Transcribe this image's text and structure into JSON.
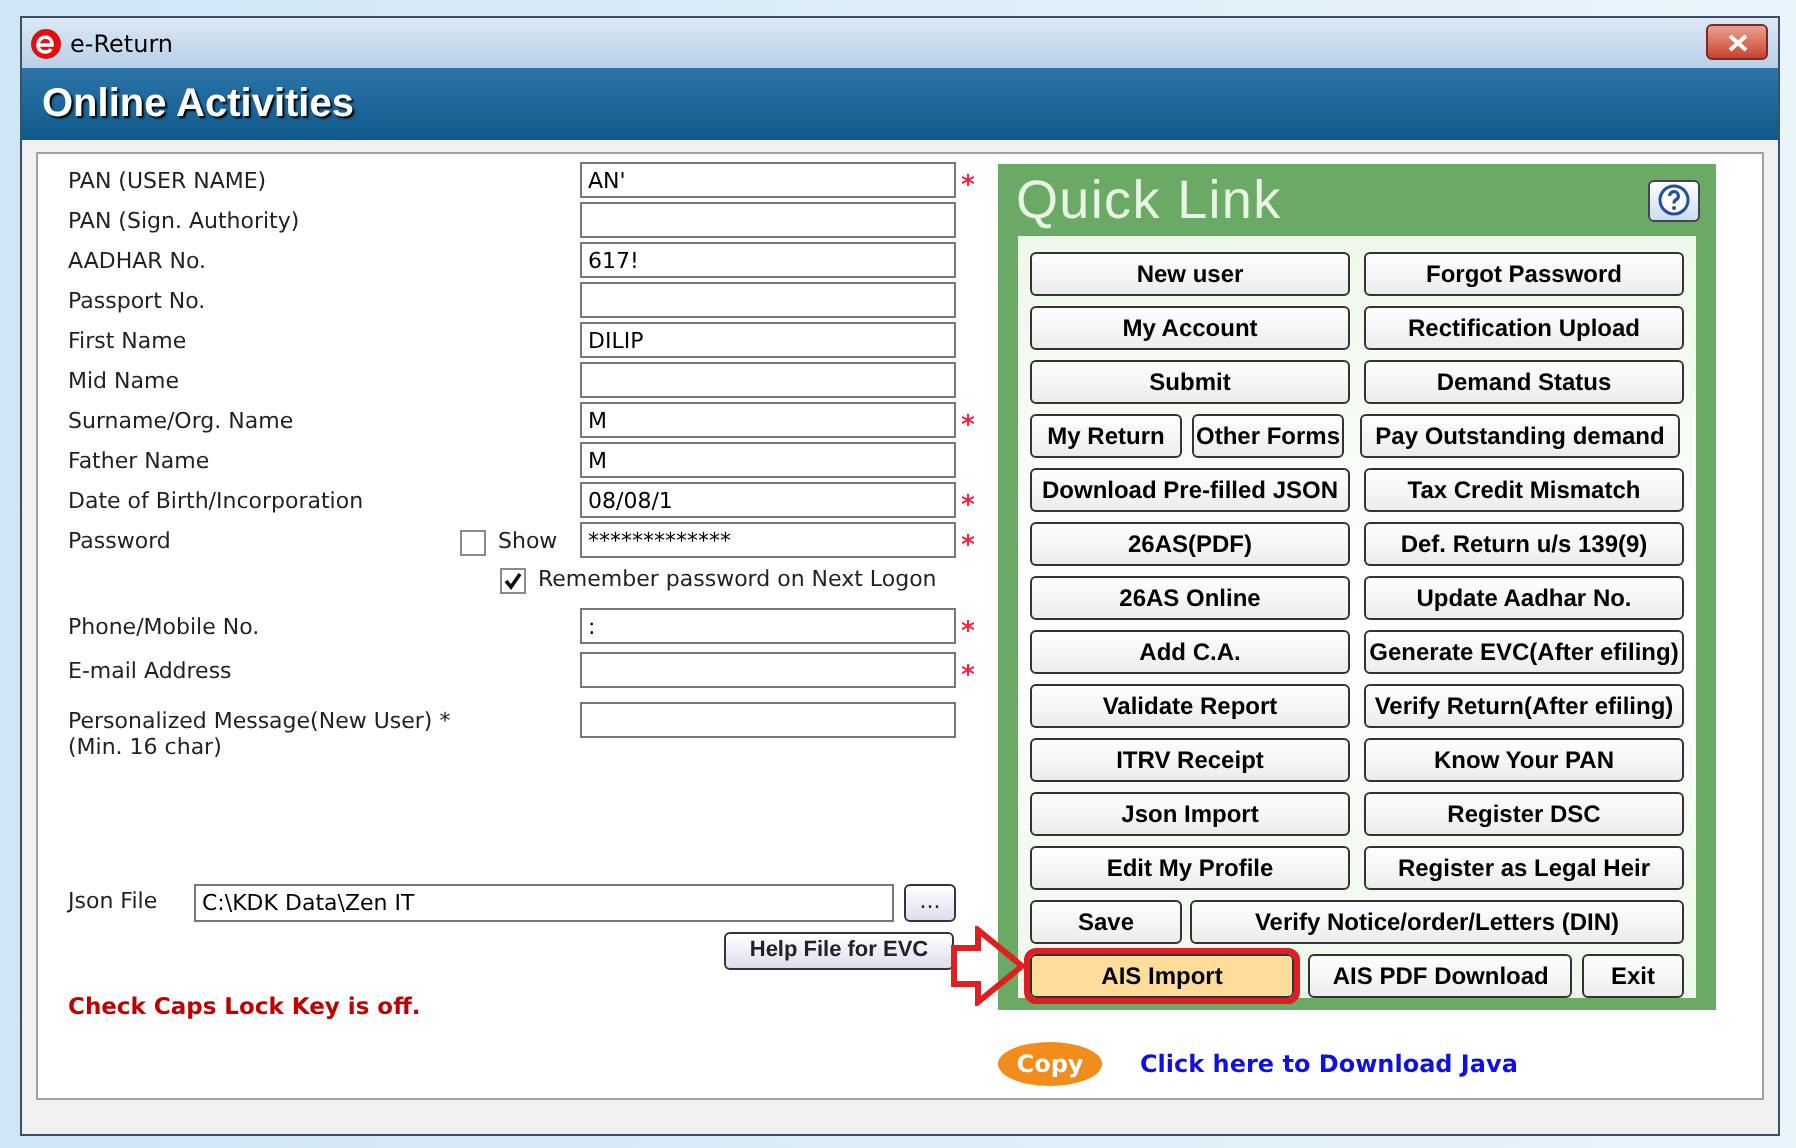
{
  "window": {
    "title": "e-Return"
  },
  "header": {
    "title": "Online Activities"
  },
  "form": {
    "fields": [
      {
        "label": "PAN (USER NAME)",
        "value": "AN'",
        "required": true
      },
      {
        "label": "PAN (Sign. Authority)",
        "required": false
      },
      {
        "label": "AADHAR No.",
        "value": "617!",
        "required": false
      },
      {
        "label": "Passport No.",
        "required": false
      },
      {
        "label": "First Name",
        "value": "DILIP",
        "required": false
      },
      {
        "label": "Mid Name",
        "required": false
      },
      {
        "label": "Surname/Org. Name",
        "value": "M",
        "required": true
      },
      {
        "label": "Father Name",
        "value": "M",
        "required": false
      },
      {
        "label": "Date of Birth/Incorporation",
        "value": "08/08/1",
        "required": true
      },
      {
        "label": "Password",
        "value": "*************",
        "required": true,
        "show": {
          "label": "Show",
          "checked": false
        }
      }
    ],
    "remember": {
      "label": "Remember password on Next Logon",
      "checked": true
    },
    "contact_fields": [
      {
        "label": "Phone/Mobile No.",
        "value": ":",
        "required": true
      },
      {
        "label": "E-mail Address",
        "required": true
      },
      {
        "label": "Personalized Message(New User) *(Min. 16 char)",
        "required": false
      }
    ],
    "json_file": {
      "label": "Json File",
      "value": "C:\\KDK Data\\Zen IT",
      "browse": "..."
    },
    "help_button": "Help File for EVC",
    "caps_message": "Check Caps Lock Key is off."
  },
  "quick_link": {
    "title": "Quick Link",
    "rows": [
      [
        {
          "label": "New user",
          "kind": "half",
          "selected": false
        },
        {
          "label": "Forgot Password",
          "kind": "half",
          "selected": false
        }
      ],
      [
        {
          "label": "My Account",
          "kind": "half",
          "selected": false
        },
        {
          "label": "Rectification Upload",
          "kind": "half",
          "selected": false
        }
      ],
      [
        {
          "label": "Submit",
          "kind": "half",
          "selected": false
        },
        {
          "label": "Demand Status",
          "kind": "half",
          "selected": false
        }
      ],
      [
        {
          "label": "My Return",
          "kind": "quarter",
          "selected": false
        },
        {
          "label": "Other Forms",
          "kind": "quarter",
          "selected": false
        },
        {
          "label": "Pay Outstanding demand",
          "kind": "half",
          "selected": false
        }
      ],
      [
        {
          "label": "Download Pre-filled JSON",
          "kind": "half",
          "selected": false
        },
        {
          "label": "Tax Credit Mismatch",
          "kind": "half",
          "selected": false
        }
      ],
      [
        {
          "label": "26AS(PDF)",
          "kind": "half",
          "selected": false
        },
        {
          "label": "Def. Return u/s 139(9)",
          "kind": "half",
          "selected": false
        }
      ],
      [
        {
          "label": "26AS Online",
          "kind": "half",
          "selected": false
        },
        {
          "label": "Update Aadhar No.",
          "kind": "half",
          "selected": false
        }
      ],
      [
        {
          "label": "Add C.A.",
          "kind": "half",
          "selected": false
        },
        {
          "label": "Generate EVC(After efiling)",
          "kind": "half",
          "selected": false
        }
      ],
      [
        {
          "label": "Validate Report",
          "kind": "half",
          "selected": false
        },
        {
          "label": "Verify Return(After efiling)",
          "kind": "half",
          "selected": false
        }
      ],
      [
        {
          "label": "ITRV Receipt",
          "kind": "half",
          "selected": false
        },
        {
          "label": "Know Your PAN",
          "kind": "half",
          "selected": false
        }
      ],
      [
        {
          "label": "Json Import",
          "kind": "half",
          "selected": false
        },
        {
          "label": "Register DSC",
          "kind": "half",
          "selected": false
        }
      ],
      [
        {
          "label": "Edit My Profile",
          "kind": "half",
          "selected": false
        },
        {
          "label": "Register as Legal Heir",
          "kind": "half",
          "selected": false
        }
      ],
      [
        {
          "label": "Save",
          "kind": "quarter",
          "selected": false
        },
        {
          "label": "Verify Notice/order/Letters (DIN)",
          "kind": "wide",
          "selected": false
        }
      ],
      [
        {
          "label": "AIS Import",
          "kind": "medium",
          "selected": true
        },
        {
          "label": "AIS PDF Download",
          "kind": "medium",
          "selected": false
        },
        {
          "label": "Exit",
          "kind": "small",
          "selected": false
        }
      ]
    ]
  },
  "copy_button": "Copy",
  "java_link": "Click here to Download Java"
}
